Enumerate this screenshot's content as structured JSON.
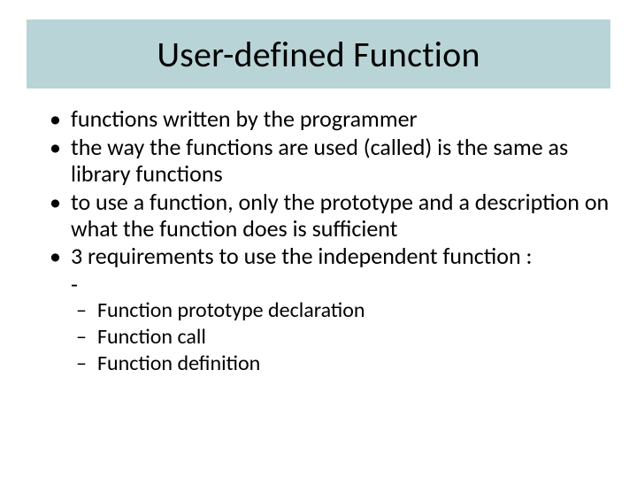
{
  "title": "User-defined Function",
  "bullets": [
    "functions written by the programmer",
    "the way the functions are used (called) is the same as library functions",
    "to use a function, only the prototype and a description on what the function does is sufficient",
    "3 requirements to use the independent function :"
  ],
  "hyphen": "-",
  "subbullets": [
    "Function prototype declaration",
    "Function call",
    "Function definition"
  ]
}
